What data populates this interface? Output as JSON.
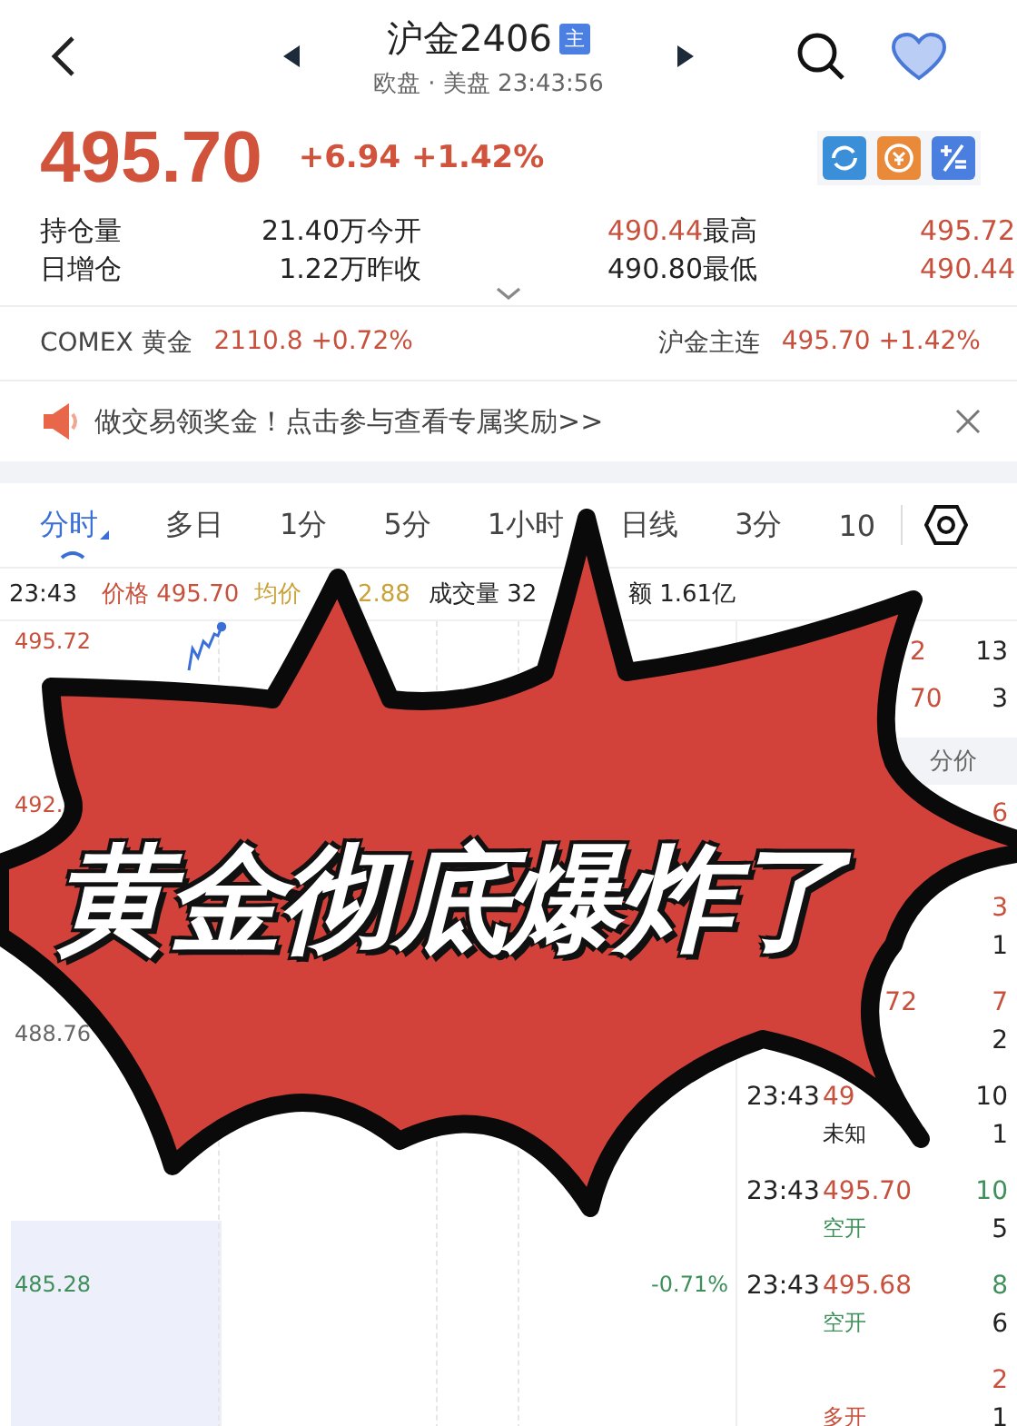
{
  "header": {
    "title": "沪金2406",
    "badge": "主",
    "subtitle": "欧盘 · 美盘 23:43:56"
  },
  "quote": {
    "price": "495.70",
    "change": "+6.94 +1.42%"
  },
  "stats": [
    {
      "label": "持仓量",
      "value": "21.40万",
      "color": "#222222"
    },
    {
      "label": "今开",
      "value": "490.44",
      "color": "#c8513d"
    },
    {
      "label": "最高",
      "value": "495.72",
      "color": "#c8513d"
    },
    {
      "label": "日增仓",
      "value": "1.22万",
      "color": "#222222"
    },
    {
      "label": "昨收",
      "value": "490.80",
      "color": "#222222"
    },
    {
      "label": "最低",
      "value": "490.44",
      "color": "#c8513d"
    }
  ],
  "related": [
    {
      "name": "COMEX 黄金",
      "value": "2110.8 +0.72%"
    },
    {
      "name": "沪金主连",
      "value": "495.70 +1.42%"
    }
  ],
  "banner": {
    "text": "做交易领奖金！点击参与查看专属奖励>>"
  },
  "tabs": [
    {
      "label": "分时",
      "selected": true
    },
    {
      "label": "多日",
      "selected": false
    },
    {
      "label": "1分",
      "selected": false
    },
    {
      "label": "5分",
      "selected": false
    },
    {
      "label": "1小时",
      "selected": false
    },
    {
      "label": "日线",
      "selected": false
    },
    {
      "label": "3分",
      "selected": false
    },
    {
      "label": "10",
      "selected": false
    }
  ],
  "info_bar": [
    {
      "kind": "time",
      "text": "23:43"
    },
    {
      "kind": "price",
      "text": "价格 495.70"
    },
    {
      "kind": "avg",
      "text": "均价"
    },
    {
      "kind": "avg_value",
      "text": "2.88"
    },
    {
      "kind": "volume",
      "text": "成交量 32"
    },
    {
      "kind": "amount",
      "text": "额 1.61亿"
    }
  ],
  "chart": {
    "y_labels": [
      {
        "text": "495.72",
        "color": "#c8513d"
      },
      {
        "text": "492.",
        "color": "#c8513d"
      },
      {
        "text": "488.76",
        "color": "#666666"
      },
      {
        "text": "485.28",
        "color": "#3f8f5a"
      }
    ],
    "pct_label": "-0.71%"
  },
  "depth": [
    {
      "price": "2",
      "volume": "13"
    },
    {
      "price": "70",
      "volume": "3"
    }
  ],
  "trades_header": "分价",
  "trades": [
    {
      "volume": {
        "text": "6",
        "color": "#c8513d"
      }
    },
    {
      "volume": {
        "text": "3",
        "color": "#c8513d"
      },
      "count": "1"
    },
    {
      "kind": "tail",
      "price": "72",
      "volume": {
        "text": "7",
        "color": "#c8513d"
      },
      "count": "2"
    },
    {
      "time": "23:43",
      "price": "49",
      "volume": {
        "text": "10",
        "color": "#222222"
      },
      "side": {
        "text": "未知",
        "color": "#222222"
      },
      "count": "1"
    },
    {
      "time": "23:43",
      "price": "495.70",
      "volume": {
        "text": "10",
        "color": "#3f8f5a"
      },
      "side": {
        "text": "空开",
        "color": "#3f8f5a"
      },
      "count": "5"
    },
    {
      "time": "23:43",
      "price": "495.68",
      "volume": {
        "text": "8",
        "color": "#3f8f5a"
      },
      "side": {
        "text": "空开",
        "color": "#3f8f5a"
      },
      "count": "6"
    },
    {
      "volume": {
        "text": "2",
        "color": "#c8513d"
      },
      "side": {
        "text": "多开",
        "color": "#c8513d"
      },
      "count": "1"
    }
  ],
  "headline": "黄金彻底爆炸了"
}
